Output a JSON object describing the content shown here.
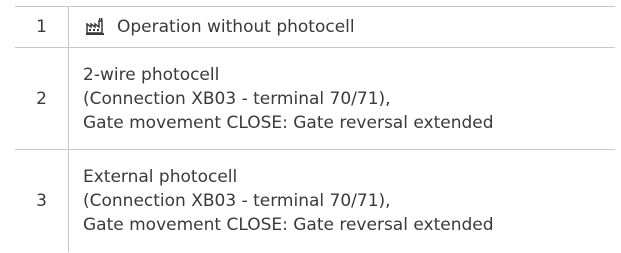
{
  "rows": [
    {
      "number": "1",
      "icon": "factory-icon",
      "lines": [
        "Operation without photocell"
      ]
    },
    {
      "number": "2",
      "lines": [
        "2-wire photocell",
        "(Connection XB03 - terminal 70/71),",
        "Gate movement CLOSE: Gate reversal extended"
      ]
    },
    {
      "number": "3",
      "lines": [
        "External photocell",
        "(Connection XB03 - terminal 70/71),",
        "Gate movement CLOSE: Gate reversal extended"
      ]
    }
  ],
  "colors": {
    "text": "#3a3a3a",
    "border": "#c8c8c8"
  }
}
